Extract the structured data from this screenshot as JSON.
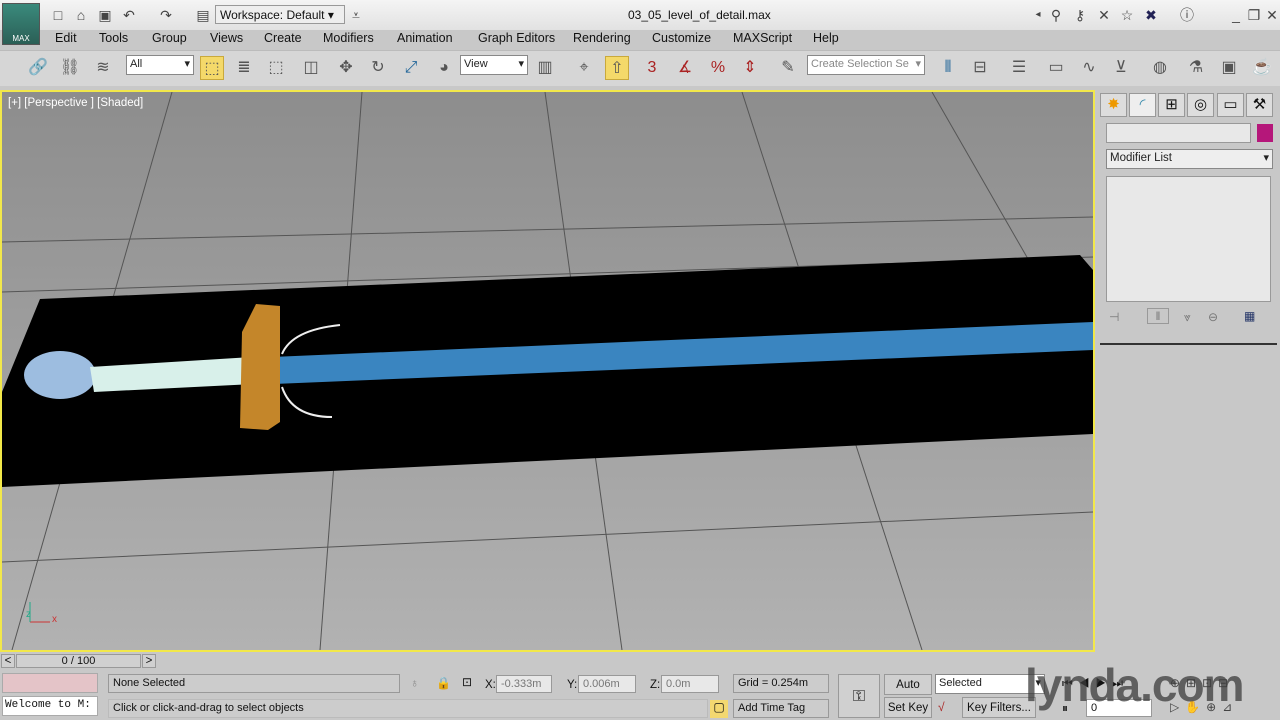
{
  "app": {
    "logo_text": "MAX",
    "file_title": "03_05_level_of_detail.max",
    "workspace": "Workspace: Default"
  },
  "menu": [
    "Edit",
    "Tools",
    "Group",
    "Views",
    "Create",
    "Modifiers",
    "Animation",
    "Graph Editors",
    "Rendering",
    "Customize",
    "MAXScript",
    "Help"
  ],
  "toolbar": {
    "selection_filter": "All",
    "reference_coord": "View",
    "snap_angle_label": "3",
    "named_selection_placeholder": "Create Selection Se"
  },
  "viewport": {
    "label": "[+] [Perspective ] [Shaded]",
    "axis_x": "x",
    "axis_z": "z"
  },
  "command_panel": {
    "object_name": "",
    "object_color": "#b5177a",
    "modifier_list": "Modifier List"
  },
  "timeline": {
    "frame": "0 / 100",
    "prev": "<",
    "next": ">"
  },
  "status": {
    "maxscript_listener": "Welcome to M:",
    "selection": "None Selected",
    "prompt": "Click or click-and-drag to select objects",
    "x_label": "X:",
    "x_value": "-0.333m",
    "y_label": "Y:",
    "y_value": "0.006m",
    "z_label": "Z:",
    "z_value": "0.0m",
    "grid": "Grid = 0.254m",
    "add_time_tag": "Add Time Tag",
    "auto_key": "Auto Key",
    "set_key": "Set Key",
    "key_mode": "Selected",
    "key_filters": "Key Filters...",
    "current_frame": "0"
  },
  "watermark": "lynda.com"
}
